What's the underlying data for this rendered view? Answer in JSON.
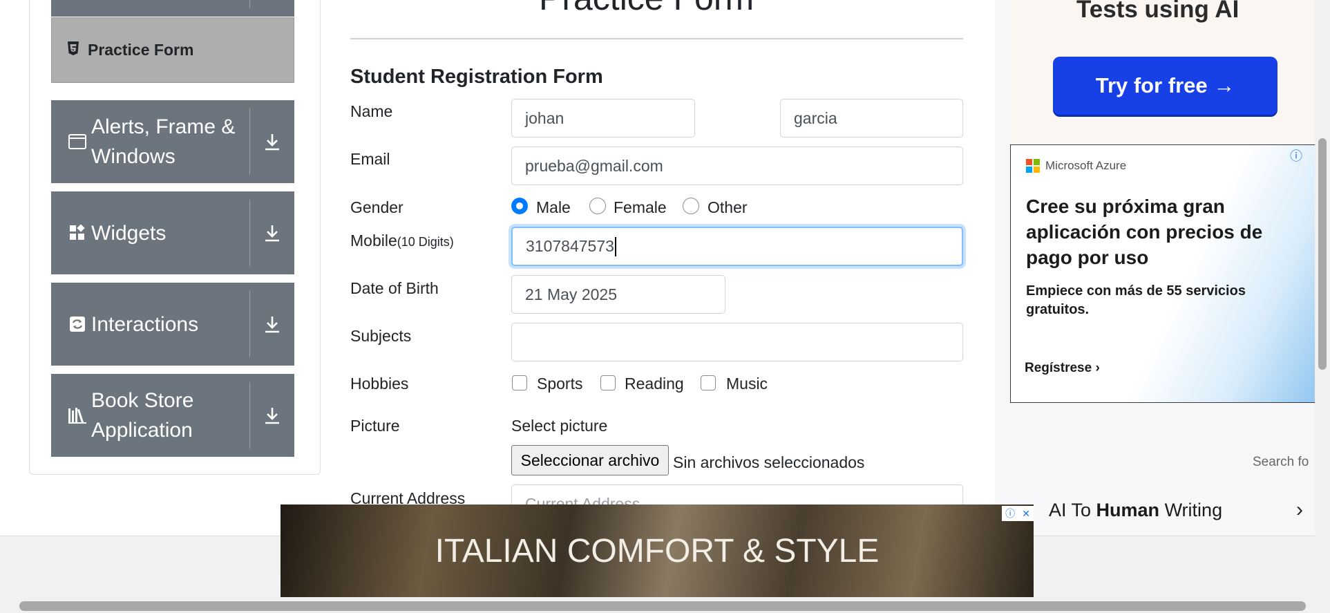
{
  "sidebar": {
    "active_item": "Practice Form",
    "groups": [
      {
        "label": "Alerts, Frame & Windows",
        "icon": "window-icon"
      },
      {
        "label": "Widgets",
        "icon": "widgets-icon"
      },
      {
        "label": "Interactions",
        "icon": "interactions-icon"
      },
      {
        "label": "Book Store Application",
        "icon": "books-icon"
      }
    ]
  },
  "main": {
    "page_title": "Practice Form",
    "form_title": "Student Registration Form",
    "labels": {
      "name": "Name",
      "email": "Email",
      "gender": "Gender",
      "mobile": "Mobile",
      "mobile_hint": "(10 Digits)",
      "dob": "Date of Birth",
      "subjects": "Subjects",
      "hobbies": "Hobbies",
      "picture": "Picture",
      "address": "Current Address"
    },
    "first_name": "johan",
    "last_name": "garcia",
    "email": "prueba@gmail.com",
    "gender_options": [
      "Male",
      "Female",
      "Other"
    ],
    "gender_selected": "Male",
    "mobile": "3107847573",
    "dob": "21 May 2025",
    "subjects": "",
    "hobby_options": [
      "Sports",
      "Reading",
      "Music"
    ],
    "picture_label": "Select picture",
    "file_button": "Seleccionar archivo",
    "file_status": "Sin archivos seleccionados",
    "address_placeholder": "Current Address"
  },
  "ads": {
    "top_title": "Tests using AI",
    "top_button": "Try for free →",
    "azure_brand": "Microsoft Azure",
    "azure_headline": "Cree su próxima gran aplicación con precios de pago por uso",
    "azure_sub": "Empiece con más de 55 servicios gratuitos.",
    "azure_cta": "Regístrese",
    "search_text": "Search fo",
    "ai_link_pre": "AI To ",
    "ai_link_bold": "Human",
    "ai_link_post": " Writing",
    "bottom_banner": "ITALIAN COMFORT & STYLE"
  },
  "colors": {
    "sidebar_group_bg": "#6c757d",
    "active_item_bg": "#aeaeae",
    "radio_selected": "#007bff",
    "try_button": "#1740e6"
  }
}
